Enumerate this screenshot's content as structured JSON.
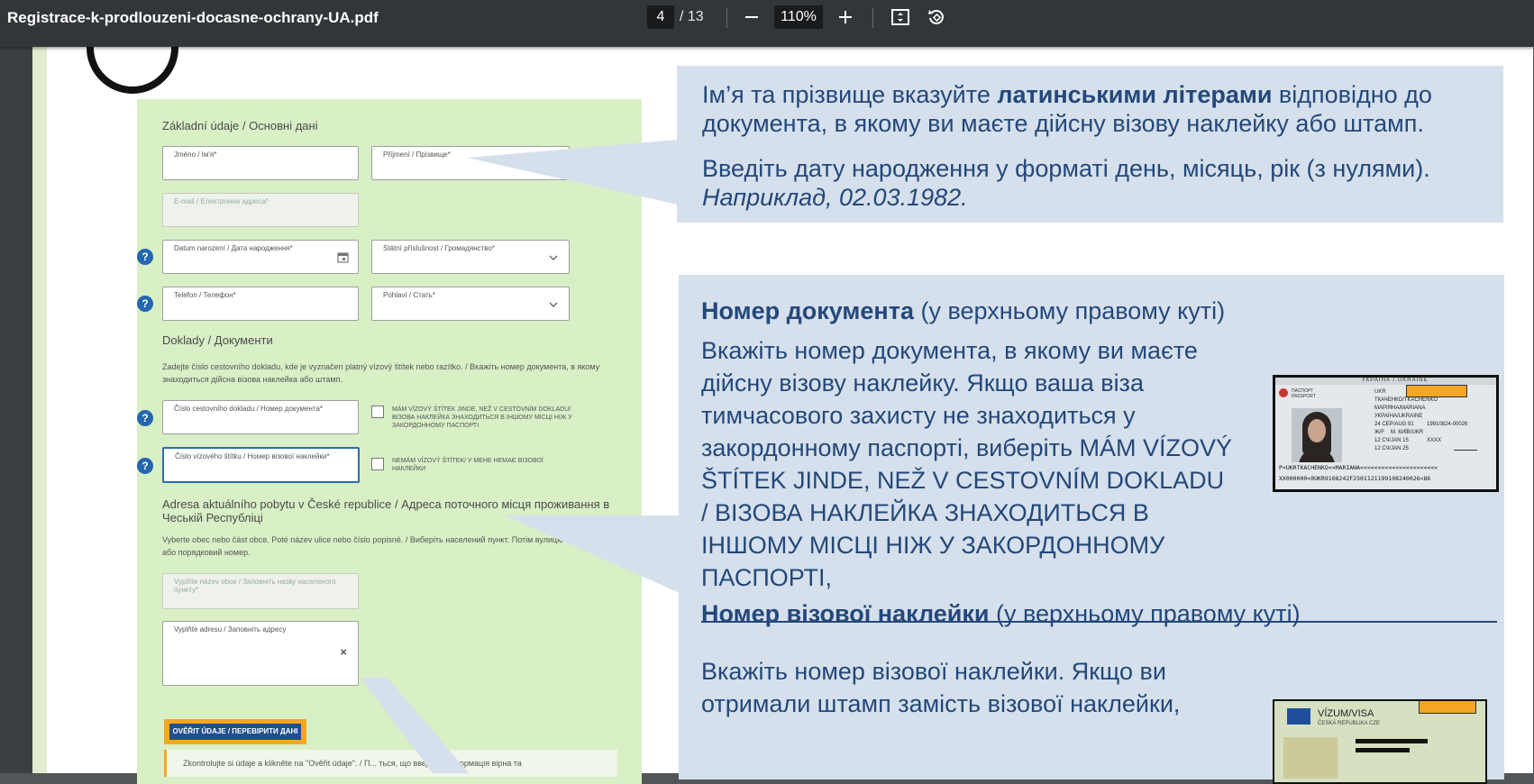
{
  "toolbar": {
    "file_name": "Registrace-k-prodlouzeni-docasne-ochrany-UA.pdf",
    "current_page": "4",
    "total_pages": "/ 13",
    "zoom": "110%"
  },
  "icons": [
    "minus-icon",
    "plus-icon",
    "fit-page-icon",
    "rotate-icon",
    "calendar-icon",
    "chevron-down-icon",
    "clear-icon",
    "help-icon"
  ],
  "form": {
    "section_basic": "Základní údaje / Основні дані",
    "first_name_label": "Jméno / Ім'я*",
    "last_name_label": "Příjmení / Прізвище*",
    "email_label": "E-mail / Електронна адреса*",
    "dob_label": "Datum narození / Дата народження*",
    "citizenship_label": "Státní příslušnost / Громадянство*",
    "phone_label": "Telefon / Телефон*",
    "gender_label": "Pohlaví / Стать*",
    "section_docs": "Doklady / Документи",
    "docs_note": "Zadejte číslo cestovního dokladu, kde je vyznačen platný vízový štítek nebo razítko. / Вкажіть номер документа, в якому знаходиться дійсна візова наклейка або штамп.",
    "doc_number_label": "Číslo cestovního dokladu / Номер документа*",
    "visa_elsewhere_label": "MÁM VÍZOVÝ ŠTÍTEK JINDE, NEŽ V CESTOVNÍM DOKLADU/ ВІЗОВА НАКЛЕЙКА ЗНАХОДИТЬСЯ В ІНШОМУ МІСЦІ НІЖ У ЗАКОРДОННОМУ ПАСПОРТІ",
    "visa_number_label": "Číslo vízového štítku / Номер візової наклейки*",
    "no_visa_label": "NEMÁM VÍZOVÝ ŠTÍTEK/ У МЕНЕ НЕМАЄ ВІЗОВОЇ НАКЛЕЙКИ",
    "section_address": "Adresa aktuálního pobytu v České republice / Адреса поточного місця проживання в Чеській Республіці",
    "address_note": "Vyberte obec nebo část obce. Poté název ulice nebo číslo popisné. / Виберіть населений пункт. Потім вулицю або порядковий номер.",
    "municipality_label": "Vyplňte název obce / Заповніть назву населеного пункту*",
    "address_label": "Vyplňte adresu / Заповніть адресу",
    "clear_symbol": "×",
    "verify_button": "OVĚŘIT ÚDAJE / ПЕРЕВІРИТИ ДАНІ",
    "info_text": "Zkontrolujte si údaje a klikněte na \"Ověřit údaje\". / П... ться, що введена інформація вірна та",
    "help_symbol": "?"
  },
  "callout_a": {
    "line1_pre": "Ім’я та прізвище вказуйте ",
    "line1_bold": "латинськими літерами",
    "line1_post": " відповідно до документа, в якому ви маєте дійсну візову наклейку або штамп.",
    "line2": "Введіть дату народження у форматі день, місяць, рік (з нулями).",
    "line3": "Наприклад, 02.03.1982."
  },
  "callout_b": {
    "heading1_bold": "Номер документа",
    "heading1_rest": " (у верхньому правому куті)",
    "body1": "Вкажіть номер документа, в якому ви маєте дійсну візову наклейку. Якщо ваша віза тимчасового захисту не знаходиться у закордонному паспорті, виберіть MÁM VÍZOVÝ ŠTÍTEK JINDE, NEŽ V CESTOVNÍM DOKLADU / ВІЗОВА НАКЛЕЙКА ЗНАХОДИТЬСЯ В ІНШОМУ МІСЦІ НІЖ У ЗАКОРДОННОМУ ПАСПОРТІ,",
    "heading2_bold": "Номер візової наклейки",
    "heading2_rest": "  (у верхньому правому куті)",
    "body2": "Вкажіть номер візової наклейки. Якщо ви отримали штамп замість візової наклейки,"
  },
  "passport_sample": {
    "header": "УКРАЇНА / UKRAINE",
    "type": "ПАСПОРТ PASSPORT",
    "country": "UKR",
    "surname": "ТКАЧЕНКО/TKACHENKO",
    "given": "МАРІЯНА/MARIANA",
    "nationality": "УКРАЇНА/UKRAINE",
    "dob": "24 СЕР/AUG 91",
    "record": "19910824-00026",
    "sex": "Ж/F",
    "place": "М. КИЇВ/UKR",
    "issued": "12 СЧ/JAN 15",
    "authority": "XXXX",
    "expiry": "12 СЧ/JAN 25",
    "mrz1": "P<UKRTKACHENKO<<MARIANA<<<<<<<<<<<<<<<<<<<<<<",
    "mrz2": "XX000000<0UKR9108242F2501121199108240026<86"
  },
  "visa_sample": {
    "title": "VÍZUM/VISA",
    "country": "ČESKÁ REPUBLIKA CZE"
  },
  "colors": {
    "toolbar": "#323639",
    "callout_bg": "#d5e0ec",
    "callout_text": "#24487a",
    "form_bg": "#d9efc6",
    "redaction": "#f5a623",
    "help": "#2267b0"
  }
}
